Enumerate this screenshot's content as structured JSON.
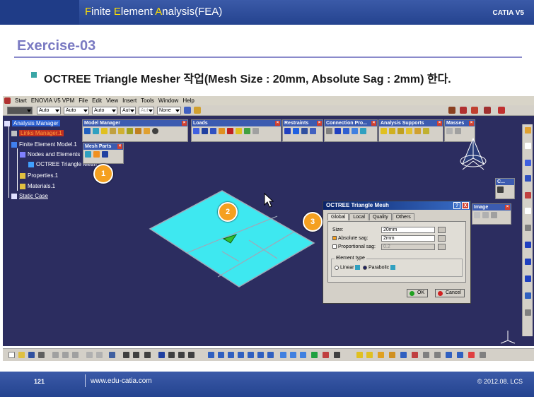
{
  "header": {
    "title_parts": [
      "F",
      "inite ",
      "E",
      "lement ",
      "A",
      "nalysis(FEA)"
    ],
    "brand": "CATIA V5"
  },
  "exercise": {
    "title": "Exercise-03",
    "subtitle": "OCTREE Triangle Mesher 작업(Mesh Size : 20mm, Absolute Sag : 2mm) 한다."
  },
  "catia": {
    "menu": [
      "Start",
      "ENOVIA V5 VPM",
      "File",
      "Edit",
      "View",
      "Insert",
      "Tools",
      "Window",
      "Help"
    ],
    "top_toolbar": {
      "color_value": "",
      "combos": [
        "Auto",
        "Auto",
        "Auto",
        "Aut",
        "Aut",
        "None"
      ]
    },
    "tree": [
      {
        "label": "Analysis Manager"
      },
      {
        "label": "Links Manager.1"
      },
      {
        "label": "Finite Element Model.1"
      },
      {
        "label": "Nodes and Elements"
      },
      {
        "label": "OCTREE Triangle Mesh"
      },
      {
        "label": "Properties.1"
      },
      {
        "label": "Materials.1"
      },
      {
        "label": "Static Case"
      }
    ],
    "toolbars": {
      "model_manager": "Model Manager",
      "mesh_parts": "Mesh Parts",
      "loads": "Loads",
      "restraints": "Restraints",
      "connection_pro": "Connection Pro...",
      "analysis_supports": "Analysis Supports",
      "masses": "Masses",
      "image": "Image",
      "c_panel": "C..."
    },
    "markers": [
      "1",
      "2",
      "3"
    ],
    "dialog": {
      "title": "OCTREE Triangle Mesh",
      "help_glyph": "?",
      "close_glyph": "X",
      "tabs": [
        "Global",
        "Local",
        "Quality",
        "Others"
      ],
      "size_label": "Size:",
      "size_value": "20mm",
      "absolute_sag_label": "Absolute sag:",
      "absolute_sag_value": "2mm",
      "proportional_sag_label": "Proportional sag:",
      "proportional_sag_value": "0.2",
      "element_type_label": "Element type",
      "linear_label": "Linear",
      "parabolic_label": "Parabolic",
      "ok_label": "OK",
      "cancel_label": "Cancel"
    },
    "colors": {
      "background": "#2c2d60",
      "mesh_fill": "#3ee8f0",
      "accent": "#f5a020"
    }
  },
  "footer": {
    "page": "121",
    "url": "www.edu-catia.com",
    "copyright": "© 2012.08. LCS"
  }
}
